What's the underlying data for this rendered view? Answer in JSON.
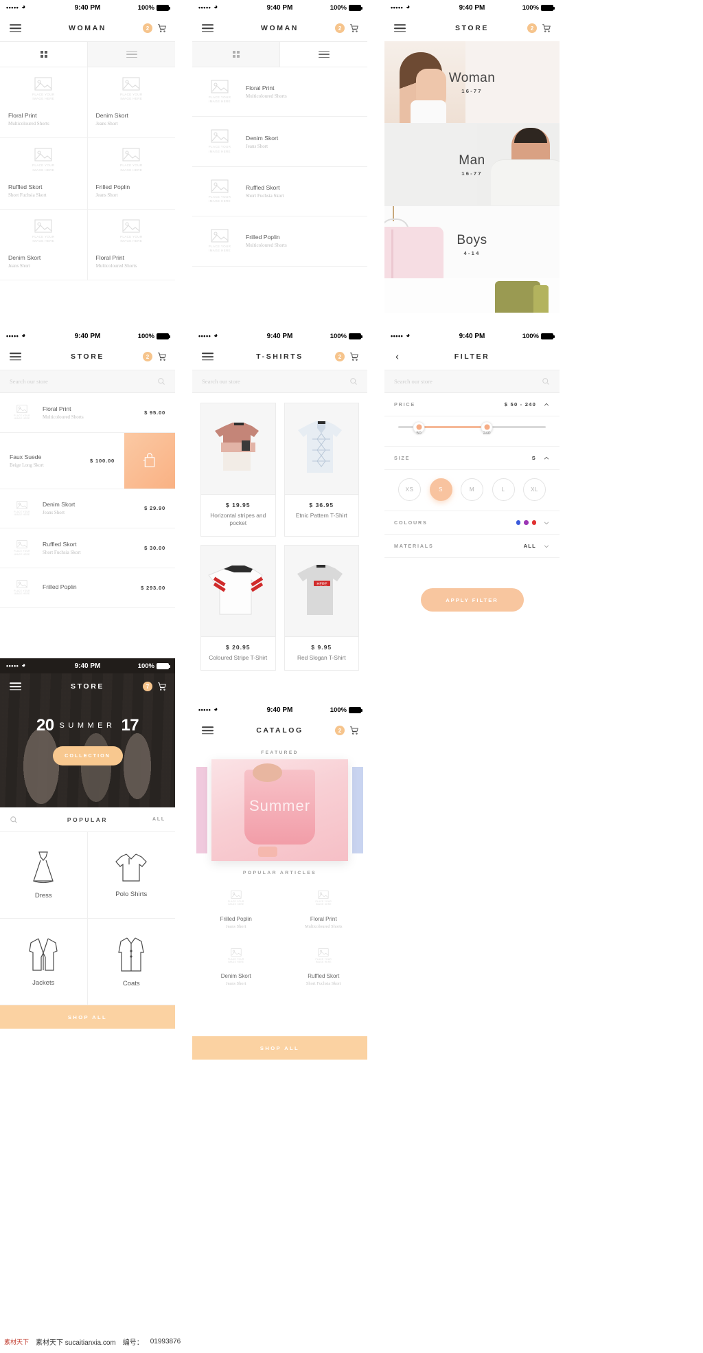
{
  "status": {
    "dots": "•••••",
    "time": "9:40 PM",
    "battery": "100%"
  },
  "screens": {
    "woman_grid": {
      "title": "WOMAN",
      "cart_count": "2",
      "tabs": {
        "grid": "grid-view",
        "list": "list-view"
      },
      "placeholder_text": "PLACE YOUR\nIMAGE HERE",
      "products": [
        {
          "name": "Floral Print",
          "sub": "Multicoloured Shorts"
        },
        {
          "name": "Denim Skort",
          "sub": "Jeans Short"
        },
        {
          "name": "Ruffled Skort",
          "sub": "Short Fuchsia Skort"
        },
        {
          "name": "Frilled Poplin",
          "sub": "Jeans Short"
        },
        {
          "name": "Denim Skort",
          "sub": "Jeans Short"
        },
        {
          "name": "Floral Print",
          "sub": "Multicoloured Shorts"
        }
      ]
    },
    "woman_list": {
      "title": "WOMAN",
      "cart_count": "2",
      "products": [
        {
          "name": "Floral Print",
          "sub": "Multicoloured Shorts"
        },
        {
          "name": "Denim Skort",
          "sub": "Jeans Short"
        },
        {
          "name": "Ruffled Skort",
          "sub": "Short Fuchsia Skort"
        },
        {
          "name": "Frilled Poplin",
          "sub": "Multicoloured Shorts"
        }
      ]
    },
    "store_categories": {
      "title": "STORE",
      "cart_count": "2",
      "categories": [
        {
          "name": "Woman",
          "age": "16-77"
        },
        {
          "name": "Man",
          "age": "16-77"
        },
        {
          "name": "Boys",
          "age": "4-14"
        }
      ]
    },
    "store_search": {
      "title": "STORE",
      "cart_count": "2",
      "search_placeholder": "Search our store",
      "products": [
        {
          "name": "Floral Print",
          "sub": "Multicoloured Shorts",
          "price": "$ 95.00",
          "highlight": false
        },
        {
          "name": "Faux Suede",
          "sub": "Beige Long Skort",
          "price": "$ 100.00",
          "highlight": true
        },
        {
          "name": "Denim Skort",
          "sub": "Jeans Short",
          "price": "$ 29.90",
          "highlight": false
        },
        {
          "name": "Ruffled Skort",
          "sub": "Short Fuchsia Skort",
          "price": "$ 30.00",
          "highlight": false
        },
        {
          "name": "Frilled Poplin",
          "sub": "",
          "price": "$ 293.00",
          "highlight": false
        }
      ]
    },
    "tshirts": {
      "title": "T-SHIRTS",
      "cart_count": "2",
      "search_placeholder": "Search our store",
      "products": [
        {
          "price": "$ 19.95",
          "name": "Horizontal stripes and pocket"
        },
        {
          "price": "$ 36.95",
          "name": "Etnic Pattern T-Shirt"
        },
        {
          "price": "$ 20.95",
          "name": "Coloured Stripe T-Shirt"
        },
        {
          "price": "$ 9.95",
          "name": "Red Slogan T-Shirt"
        }
      ]
    },
    "filter": {
      "title": "FILTER",
      "search_placeholder": "Search our store",
      "price": {
        "label": "PRICE",
        "value": "$ 50 - 240",
        "min_tick": "50",
        "max_tick": "240",
        "min": 50,
        "max": 240,
        "range_start": 0,
        "range_end": 400
      },
      "size": {
        "label": "SIZE",
        "value": "S",
        "options": [
          "XS",
          "S",
          "M",
          "L",
          "XL"
        ],
        "selected": "S"
      },
      "colours": {
        "label": "COLOURS",
        "swatches": [
          "#3b5bdb",
          "#9c36b5",
          "#e03131"
        ]
      },
      "materials": {
        "label": "MATERIALS",
        "value": "ALL"
      },
      "apply_label": "APPLY FILTER"
    },
    "store_hero": {
      "title": "STORE",
      "cart_count": "7",
      "hero": {
        "year_left": "20",
        "word": "SUMMER",
        "year_right": "17",
        "button": "COLLECTION"
      },
      "popular": {
        "title": "POPULAR",
        "all": "ALL"
      },
      "categories": [
        {
          "name": "Dress"
        },
        {
          "name": "Polo Shirts"
        },
        {
          "name": "Jackets"
        },
        {
          "name": "Coats"
        }
      ],
      "shop_all": "SHOP ALL"
    },
    "catalog": {
      "title": "CATALOG",
      "cart_count": "2",
      "featured_label": "FEATURED",
      "carousel_word": "Summer",
      "popular_label": "POPULAR ARTICLES",
      "articles": [
        {
          "name": "Frilled Poplin",
          "sub": "Jeans Short"
        },
        {
          "name": "Floral Print",
          "sub": "Multicoloured Shorts"
        },
        {
          "name": "Denim Skort",
          "sub": "Jeans Short"
        },
        {
          "name": "Ruffled Skort",
          "sub": "Short Fuchsia Skort"
        }
      ],
      "shop_all": "SHOP ALL"
    }
  },
  "footer": {
    "site": "素材天下 sucaitianxia.com",
    "label": "编号：",
    "number": "01993876"
  },
  "colors": {
    "accent": "#f8c69f",
    "accent_strong": "#f6ad86",
    "badge": "#f6c48c",
    "shop_all": "#fbd2a2"
  }
}
